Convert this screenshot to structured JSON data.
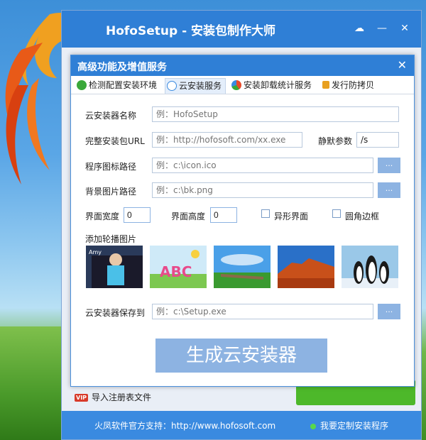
{
  "main_window": {
    "title": "HofoSetup - 安装包制作大师",
    "buttons": {
      "cloud": "☁",
      "minimize": "—",
      "close": "✕"
    }
  },
  "dialog": {
    "title": "高级功能及增值服务",
    "close": "✕",
    "tabs": [
      {
        "label": "检测配置安装环境",
        "icon": "check-circle-icon",
        "color": "#3aa83a"
      },
      {
        "label": "云安装服务",
        "icon": "cloud-icon",
        "color": "#3a8ae0"
      },
      {
        "label": "安装卸载统计服务",
        "icon": "pie-chart-icon",
        "color": "#e84a2a"
      },
      {
        "label": "发行防拷贝",
        "icon": "lock-icon",
        "color": "#e8a020"
      }
    ],
    "form": {
      "installer_name_label": "云安装器名称",
      "installer_name_placeholder": "例：HofoSetup",
      "package_url_label": "完整安装包URL",
      "package_url_placeholder": "例：http://hofosoft.com/xx.exe",
      "silent_param_label": "静默参数",
      "silent_param_value": "/s",
      "icon_path_label": "程序图标路径",
      "icon_path_placeholder": "例：c:\\icon.ico",
      "bg_path_label": "背景图片路径",
      "bg_path_placeholder": "例：c:\\bk.png",
      "browse_label": "...",
      "width_label": "界面宽度",
      "width_value": "0",
      "height_label": "界面高度",
      "height_value": "0",
      "shaped_label": "异形界面",
      "rounded_label": "圆角边框",
      "carousel_label": "添加轮播图片",
      "save_label": "云安装器保存到",
      "save_placeholder": "例：c:\\Setup.exe",
      "generate_button": "生成云安装器"
    },
    "carousel": [
      {
        "name": "thumb-girl",
        "caption": "Amy"
      },
      {
        "name": "thumb-abc-kids",
        "caption": "ABC"
      },
      {
        "name": "thumb-landscape",
        "caption": ""
      },
      {
        "name": "thumb-desert",
        "caption": ""
      },
      {
        "name": "thumb-penguins",
        "caption": ""
      }
    ]
  },
  "bottom": {
    "vip_badge": "VIP",
    "import_registry": "导入注册表文件",
    "footer_left": "火凤软件官方支持：http://www.hofosoft.com",
    "footer_right": "我要定制安装程序"
  }
}
